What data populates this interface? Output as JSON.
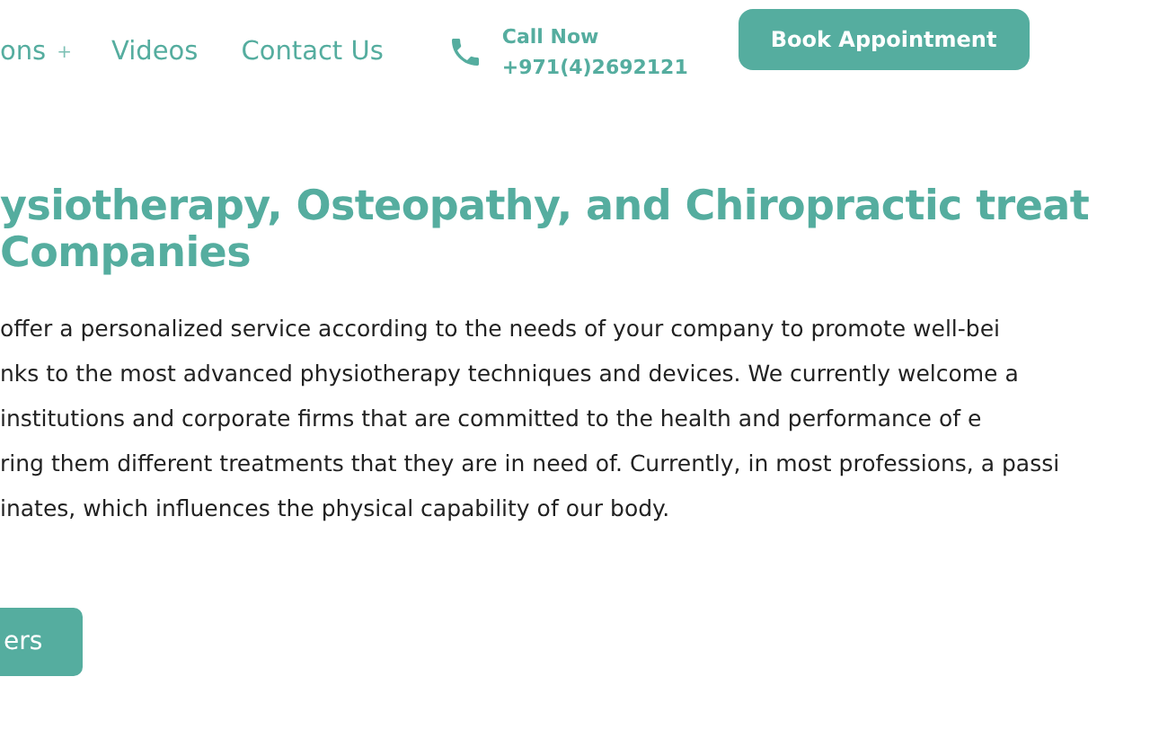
{
  "nav": {
    "items": [
      {
        "label": "ons",
        "submenu_mark": "+"
      },
      {
        "label": "Videos"
      },
      {
        "label": "Contact Us"
      }
    ],
    "call": {
      "label": "Call Now",
      "phone": "+971(4)2692121"
    },
    "cta": "Book Appointment"
  },
  "heading": [
    "ysiotherapy, Osteopathy, and Chiropractic treat",
    "Companies"
  ],
  "paragraph": [
    "offer a personalized service according to the needs of your company to promote well-bei",
    "nks to the most advanced physiotherapy techniques and devices. We currently welcome a",
    "institutions and corporate firms that are committed to the health and performance of e",
    "ring them different treatments that they are in need of. Currently, in most professions, a passi",
    "inates, which influences the physical capability of our body."
  ],
  "button": "ers"
}
